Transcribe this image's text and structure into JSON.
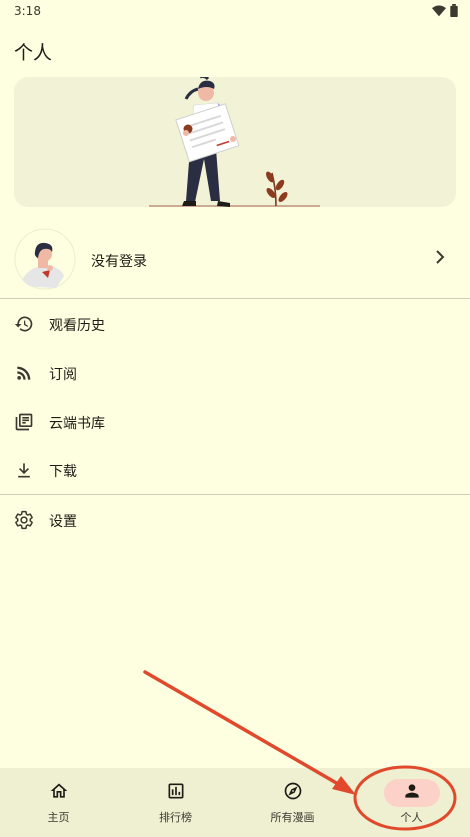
{
  "status_bar": {
    "time": "3:18"
  },
  "page": {
    "title": "个人"
  },
  "login": {
    "label": "没有登录"
  },
  "menu": [
    {
      "label": "观看历史",
      "icon": "history-icon"
    },
    {
      "label": "订阅",
      "icon": "rss-feed-icon"
    },
    {
      "label": "云端书库",
      "icon": "library-books-icon"
    },
    {
      "label": "下载",
      "icon": "download-icon"
    },
    {
      "label": "设置",
      "icon": "settings-gear-icon"
    }
  ],
  "bottom_nav": [
    {
      "label": "主页",
      "icon": "home-icon",
      "active": false
    },
    {
      "label": "排行榜",
      "icon": "leaderboard-icon",
      "active": false
    },
    {
      "label": "所有漫画",
      "icon": "compass-icon",
      "active": false
    },
    {
      "label": "个人",
      "icon": "person-icon",
      "active": true
    }
  ],
  "colors": {
    "background": "#fefee0",
    "hero_background": "#f2f2d6",
    "nav_background": "#efefd2",
    "active_pill": "#fcd2c8",
    "annotation_red": "#e0492c"
  }
}
